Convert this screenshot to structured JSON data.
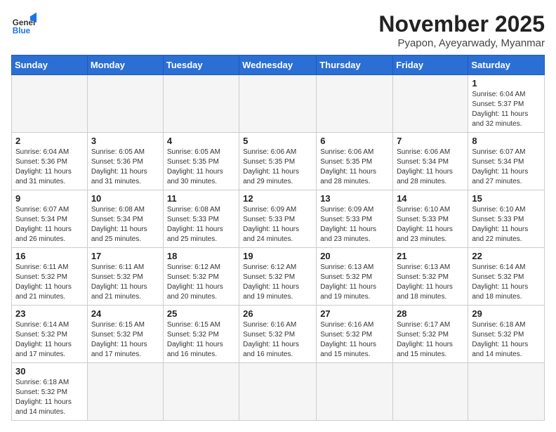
{
  "header": {
    "logo_general": "General",
    "logo_blue": "Blue",
    "month_title": "November 2025",
    "location": "Pyapon, Ayeyarwady, Myanmar"
  },
  "weekdays": [
    "Sunday",
    "Monday",
    "Tuesday",
    "Wednesday",
    "Thursday",
    "Friday",
    "Saturday"
  ],
  "days": {
    "1": {
      "sunrise": "6:04 AM",
      "sunset": "5:37 PM",
      "daylight": "11 hours and 32 minutes."
    },
    "2": {
      "sunrise": "6:04 AM",
      "sunset": "5:36 PM",
      "daylight": "11 hours and 31 minutes."
    },
    "3": {
      "sunrise": "6:05 AM",
      "sunset": "5:36 PM",
      "daylight": "11 hours and 31 minutes."
    },
    "4": {
      "sunrise": "6:05 AM",
      "sunset": "5:35 PM",
      "daylight": "11 hours and 30 minutes."
    },
    "5": {
      "sunrise": "6:06 AM",
      "sunset": "5:35 PM",
      "daylight": "11 hours and 29 minutes."
    },
    "6": {
      "sunrise": "6:06 AM",
      "sunset": "5:35 PM",
      "daylight": "11 hours and 28 minutes."
    },
    "7": {
      "sunrise": "6:06 AM",
      "sunset": "5:34 PM",
      "daylight": "11 hours and 28 minutes."
    },
    "8": {
      "sunrise": "6:07 AM",
      "sunset": "5:34 PM",
      "daylight": "11 hours and 27 minutes."
    },
    "9": {
      "sunrise": "6:07 AM",
      "sunset": "5:34 PM",
      "daylight": "11 hours and 26 minutes."
    },
    "10": {
      "sunrise": "6:08 AM",
      "sunset": "5:34 PM",
      "daylight": "11 hours and 25 minutes."
    },
    "11": {
      "sunrise": "6:08 AM",
      "sunset": "5:33 PM",
      "daylight": "11 hours and 25 minutes."
    },
    "12": {
      "sunrise": "6:09 AM",
      "sunset": "5:33 PM",
      "daylight": "11 hours and 24 minutes."
    },
    "13": {
      "sunrise": "6:09 AM",
      "sunset": "5:33 PM",
      "daylight": "11 hours and 23 minutes."
    },
    "14": {
      "sunrise": "6:10 AM",
      "sunset": "5:33 PM",
      "daylight": "11 hours and 23 minutes."
    },
    "15": {
      "sunrise": "6:10 AM",
      "sunset": "5:33 PM",
      "daylight": "11 hours and 22 minutes."
    },
    "16": {
      "sunrise": "6:11 AM",
      "sunset": "5:32 PM",
      "daylight": "11 hours and 21 minutes."
    },
    "17": {
      "sunrise": "6:11 AM",
      "sunset": "5:32 PM",
      "daylight": "11 hours and 21 minutes."
    },
    "18": {
      "sunrise": "6:12 AM",
      "sunset": "5:32 PM",
      "daylight": "11 hours and 20 minutes."
    },
    "19": {
      "sunrise": "6:12 AM",
      "sunset": "5:32 PM",
      "daylight": "11 hours and 19 minutes."
    },
    "20": {
      "sunrise": "6:13 AM",
      "sunset": "5:32 PM",
      "daylight": "11 hours and 19 minutes."
    },
    "21": {
      "sunrise": "6:13 AM",
      "sunset": "5:32 PM",
      "daylight": "11 hours and 18 minutes."
    },
    "22": {
      "sunrise": "6:14 AM",
      "sunset": "5:32 PM",
      "daylight": "11 hours and 18 minutes."
    },
    "23": {
      "sunrise": "6:14 AM",
      "sunset": "5:32 PM",
      "daylight": "11 hours and 17 minutes."
    },
    "24": {
      "sunrise": "6:15 AM",
      "sunset": "5:32 PM",
      "daylight": "11 hours and 17 minutes."
    },
    "25": {
      "sunrise": "6:15 AM",
      "sunset": "5:32 PM",
      "daylight": "11 hours and 16 minutes."
    },
    "26": {
      "sunrise": "6:16 AM",
      "sunset": "5:32 PM",
      "daylight": "11 hours and 16 minutes."
    },
    "27": {
      "sunrise": "6:16 AM",
      "sunset": "5:32 PM",
      "daylight": "11 hours and 15 minutes."
    },
    "28": {
      "sunrise": "6:17 AM",
      "sunset": "5:32 PM",
      "daylight": "11 hours and 15 minutes."
    },
    "29": {
      "sunrise": "6:18 AM",
      "sunset": "5:32 PM",
      "daylight": "11 hours and 14 minutes."
    },
    "30": {
      "sunrise": "6:18 AM",
      "sunset": "5:32 PM",
      "daylight": "11 hours and 14 minutes."
    }
  }
}
